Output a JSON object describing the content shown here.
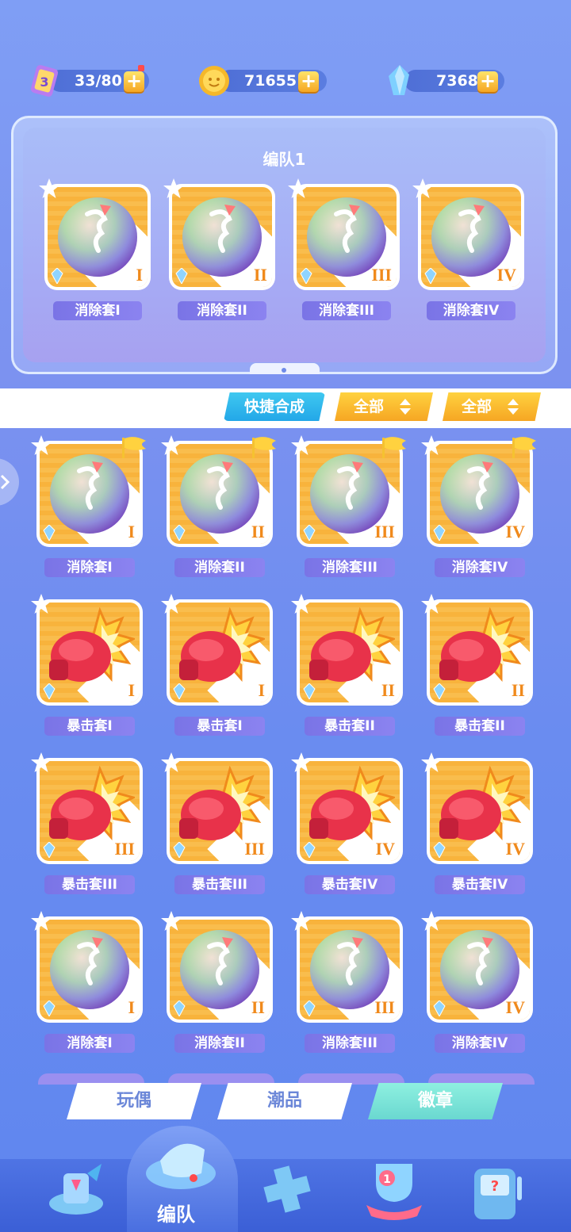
{
  "resources": {
    "energy": {
      "value": "33/80",
      "icon": "energy-card-icon"
    },
    "coins": {
      "value": "71655",
      "icon": "coin-icon"
    },
    "gems": {
      "value": "7368",
      "icon": "crystal-icon"
    }
  },
  "team": {
    "title": "编队1",
    "slots": [
      {
        "label": "消除套I",
        "roman": "I",
        "type": "orb"
      },
      {
        "label": "消除套II",
        "roman": "II",
        "type": "orb"
      },
      {
        "label": "消除套III",
        "roman": "III",
        "type": "orb"
      },
      {
        "label": "消除套IV",
        "roman": "IV",
        "type": "orb"
      }
    ]
  },
  "filters": {
    "quick_merge": "快捷合成",
    "filter1": "全部",
    "filter2": "全部"
  },
  "inventory": [
    {
      "label": "消除套I",
      "roman": "I",
      "type": "orb",
      "flag": true
    },
    {
      "label": "消除套II",
      "roman": "II",
      "type": "orb",
      "flag": true
    },
    {
      "label": "消除套III",
      "roman": "III",
      "type": "orb",
      "flag": true
    },
    {
      "label": "消除套IV",
      "roman": "IV",
      "type": "orb",
      "flag": true
    },
    {
      "label": "暴击套I",
      "roman": "I",
      "type": "glove"
    },
    {
      "label": "暴击套I",
      "roman": "I",
      "type": "glove"
    },
    {
      "label": "暴击套II",
      "roman": "II",
      "type": "glove"
    },
    {
      "label": "暴击套II",
      "roman": "II",
      "type": "glove"
    },
    {
      "label": "暴击套III",
      "roman": "III",
      "type": "glove"
    },
    {
      "label": "暴击套III",
      "roman": "III",
      "type": "glove"
    },
    {
      "label": "暴击套IV",
      "roman": "IV",
      "type": "glove"
    },
    {
      "label": "暴击套IV",
      "roman": "IV",
      "type": "glove"
    },
    {
      "label": "消除套I",
      "roman": "I",
      "type": "orb"
    },
    {
      "label": "消除套II",
      "roman": "II",
      "type": "orb"
    },
    {
      "label": "消除套III",
      "roman": "III",
      "type": "orb"
    },
    {
      "label": "消除套IV",
      "roman": "IV",
      "type": "orb"
    }
  ],
  "subtabs": [
    "玩偶",
    "潮品",
    "徽章"
  ],
  "active_subtab": "徽章",
  "nav": {
    "active_label": "编队",
    "items": [
      "home-icon",
      "whistle-icon",
      "gamepad-icon",
      "trophy-icon",
      "slot-machine-icon"
    ]
  }
}
